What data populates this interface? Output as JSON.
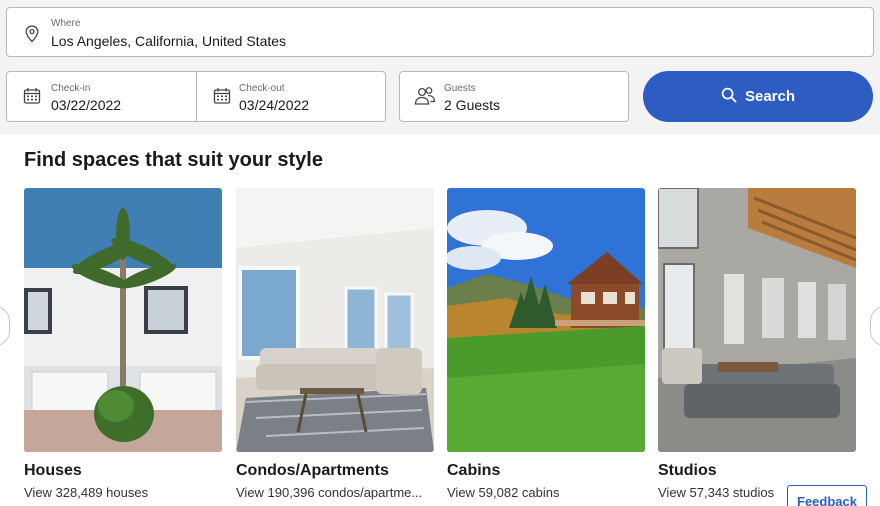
{
  "search": {
    "where_label": "Where",
    "where_value": "Los Angeles, California, United States",
    "checkin_label": "Check-in",
    "checkin_value": "03/22/2022",
    "checkout_label": "Check-out",
    "checkout_value": "03/24/2022",
    "guests_label": "Guests",
    "guests_value": "2 Guests",
    "search_button": "Search"
  },
  "section": {
    "title": "Find spaces that suit your style"
  },
  "cards": [
    {
      "title": "Houses",
      "subtitle": "View 328,489 houses"
    },
    {
      "title": "Condos/Apartments",
      "subtitle": "View 190,396 condos/apartme..."
    },
    {
      "title": "Cabins",
      "subtitle": "View 59,082 cabins"
    },
    {
      "title": "Studios",
      "subtitle": "View 57,343 studios"
    }
  ],
  "feedback": {
    "label": "Feedback"
  },
  "colors": {
    "accent": "#2d5cc2",
    "panel_bg": "#f3f3f3"
  },
  "icons": {
    "where": "location-pin-icon",
    "checkin": "calendar-icon",
    "checkout": "calendar-icon",
    "guests": "people-icon",
    "search": "search-icon"
  }
}
